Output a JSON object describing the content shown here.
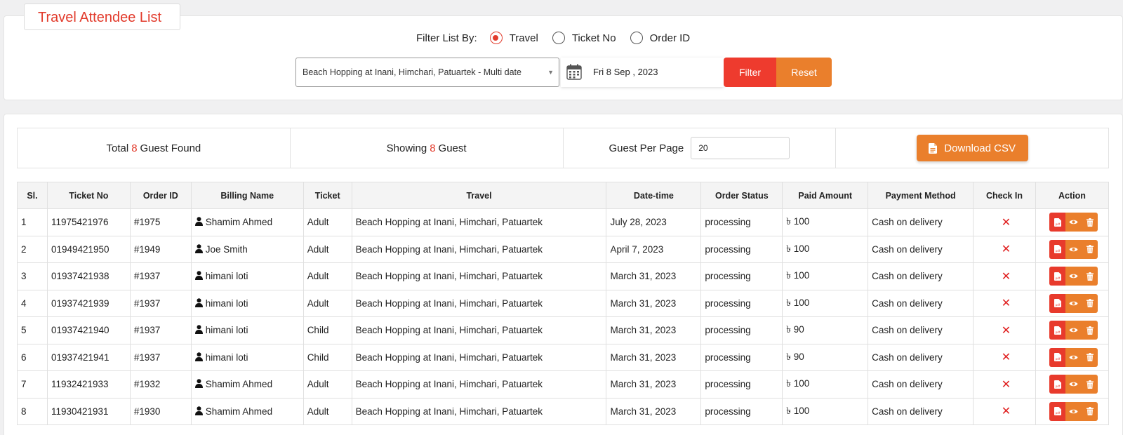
{
  "page": {
    "title": "Travel Attendee List"
  },
  "filter": {
    "label": "Filter List By:",
    "options": [
      {
        "label": "Travel",
        "checked": true
      },
      {
        "label": "Ticket No",
        "checked": false
      },
      {
        "label": "Order ID",
        "checked": false
      }
    ],
    "travel_select_value": "Beach Hopping at Inani, Himchari, Patuartek - Multi date",
    "date_value": "Fri 8 Sep , 2023",
    "filter_button": "Filter",
    "reset_button": "Reset"
  },
  "summary": {
    "total_prefix": "Total",
    "total_count": "8",
    "total_suffix": "Guest Found",
    "showing_prefix": "Showing",
    "showing_count": "8",
    "showing_suffix": "Guest",
    "per_page_label": "Guest Per Page",
    "per_page_value": "20",
    "download_csv": "Download CSV"
  },
  "table": {
    "headers": [
      "Sl.",
      "Ticket No",
      "Order ID",
      "Billing Name",
      "Ticket",
      "Travel",
      "Date-time",
      "Order Status",
      "Paid Amount",
      "Payment Method",
      "Check In",
      "Action"
    ],
    "rows": [
      {
        "sl": "1",
        "ticket_no": "11975421976",
        "order_id": "#1975",
        "billing_name": "Shamim Ahmed",
        "ticket": "Adult",
        "travel": "Beach Hopping at Inani, Himchari, Patuartek",
        "date": "July 28, 2023",
        "status": "processing",
        "amount": "৳ 100",
        "payment": "Cash on delivery",
        "check_in": "✕"
      },
      {
        "sl": "2",
        "ticket_no": "01949421950",
        "order_id": "#1949",
        "billing_name": "Joe Smith",
        "ticket": "Adult",
        "travel": "Beach Hopping at Inani, Himchari, Patuartek",
        "date": "April 7, 2023",
        "status": "processing",
        "amount": "৳ 100",
        "payment": "Cash on delivery",
        "check_in": "✕"
      },
      {
        "sl": "3",
        "ticket_no": "01937421938",
        "order_id": "#1937",
        "billing_name": "himani loti",
        "ticket": "Adult",
        "travel": "Beach Hopping at Inani, Himchari, Patuartek",
        "date": "March 31, 2023",
        "status": "processing",
        "amount": "৳ 100",
        "payment": "Cash on delivery",
        "check_in": "✕"
      },
      {
        "sl": "4",
        "ticket_no": "01937421939",
        "order_id": "#1937",
        "billing_name": "himani loti",
        "ticket": "Adult",
        "travel": "Beach Hopping at Inani, Himchari, Patuartek",
        "date": "March 31, 2023",
        "status": "processing",
        "amount": "৳ 100",
        "payment": "Cash on delivery",
        "check_in": "✕"
      },
      {
        "sl": "5",
        "ticket_no": "01937421940",
        "order_id": "#1937",
        "billing_name": "himani loti",
        "ticket": "Child",
        "travel": "Beach Hopping at Inani, Himchari, Patuartek",
        "date": "March 31, 2023",
        "status": "processing",
        "amount": "৳ 90",
        "payment": "Cash on delivery",
        "check_in": "✕"
      },
      {
        "sl": "6",
        "ticket_no": "01937421941",
        "order_id": "#1937",
        "billing_name": "himani loti",
        "ticket": "Child",
        "travel": "Beach Hopping at Inani, Himchari, Patuartek",
        "date": "March 31, 2023",
        "status": "processing",
        "amount": "৳ 90",
        "payment": "Cash on delivery",
        "check_in": "✕"
      },
      {
        "sl": "7",
        "ticket_no": "11932421933",
        "order_id": "#1932",
        "billing_name": "Shamim Ahmed",
        "ticket": "Adult",
        "travel": "Beach Hopping at Inani, Himchari, Patuartek",
        "date": "March 31, 2023",
        "status": "processing",
        "amount": "৳ 100",
        "payment": "Cash on delivery",
        "check_in": "✕"
      },
      {
        "sl": "8",
        "ticket_no": "11930421931",
        "order_id": "#1930",
        "billing_name": "Shamim Ahmed",
        "ticket": "Adult",
        "travel": "Beach Hopping at Inani, Himchari, Patuartek",
        "date": "March 31, 2023",
        "status": "processing",
        "amount": "৳ 100",
        "payment": "Cash on delivery",
        "check_in": "✕"
      }
    ],
    "row_actions": [
      "pdf-icon",
      "eye-icon",
      "trash-icon"
    ]
  },
  "colors": {
    "accent_red": "#e23b2c",
    "filter_red": "#ee3b2e",
    "orange": "#ea7f2c"
  }
}
